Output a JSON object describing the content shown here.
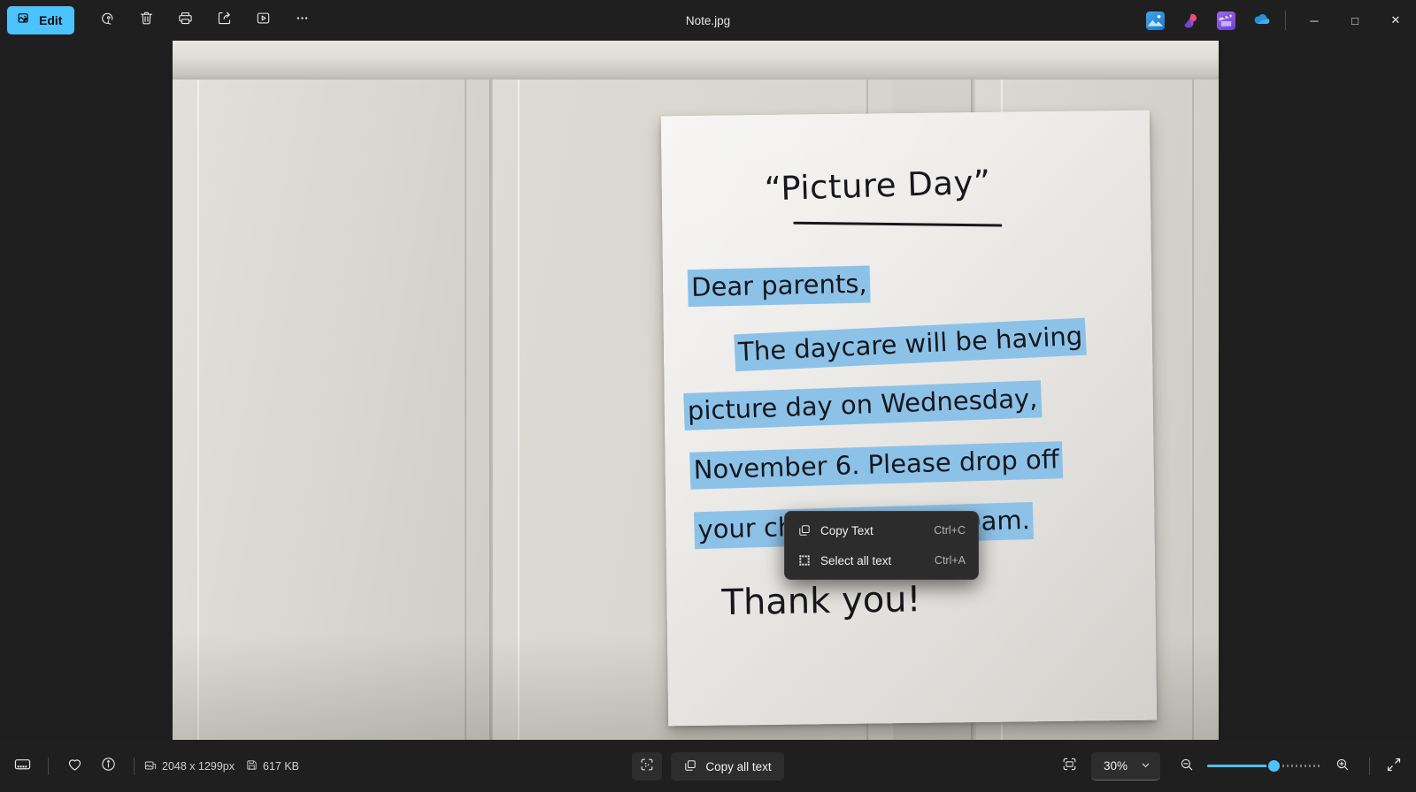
{
  "window": {
    "title": "Note.jpg",
    "accent_color": "#4cc2ff",
    "highlight_color": "#8dc2e8",
    "background_color": "#1f1f1f"
  },
  "toolbar": {
    "edit_label": "Edit",
    "buttons": [
      {
        "name": "edit-button",
        "label": "Edit",
        "icon": "edit-image-icon"
      },
      {
        "name": "rotate-button",
        "label": "Rotate",
        "icon": "rotate-icon"
      },
      {
        "name": "delete-button",
        "label": "Delete",
        "icon": "trash-icon"
      },
      {
        "name": "print-button",
        "label": "Print",
        "icon": "printer-icon"
      },
      {
        "name": "share-button",
        "label": "Share",
        "icon": "share-icon"
      },
      {
        "name": "slideshow-button",
        "label": "Slideshow",
        "icon": "play-box-icon"
      },
      {
        "name": "more-button",
        "label": "See more",
        "icon": "ellipsis-icon"
      }
    ],
    "app_icons": [
      {
        "name": "photos-app-icon",
        "label": "Photos"
      },
      {
        "name": "designer-app-icon",
        "label": "Designer"
      },
      {
        "name": "clipchamp-app-icon",
        "label": "Clipchamp"
      },
      {
        "name": "onedrive-app-icon",
        "label": "OneDrive"
      }
    ],
    "window_controls": {
      "minimize": "─",
      "maximize": "□",
      "close": "✕"
    }
  },
  "photo": {
    "alt": "Handwritten note taped to a white cabinet door",
    "note": {
      "title": "“Picture Day”",
      "lines": [
        "Dear parents,",
        "The daycare will be having",
        "picture day on Wednesday,",
        "November 6. Please drop off",
        "your child before 9:00am.",
        "Thank you!"
      ],
      "highlighted_lines": [
        0,
        1,
        2,
        3,
        4
      ]
    }
  },
  "context_menu": {
    "items": [
      {
        "name": "copy-text",
        "label": "Copy Text",
        "accel": "Ctrl+C",
        "icon": "copy-icon"
      },
      {
        "name": "select-all-text",
        "label": "Select all text",
        "accel": "Ctrl+A",
        "icon": "select-all-icon"
      }
    ]
  },
  "statusbar": {
    "left_icons": [
      {
        "name": "filmstrip-toggle-button",
        "label": "Filmstrip"
      },
      {
        "name": "favorite-button",
        "label": "Add to favorites"
      },
      {
        "name": "info-button",
        "label": "File info"
      }
    ],
    "dimensions": "2048 x 1299px",
    "filesize": "617 KB",
    "scan_text_label": "Scan text",
    "copy_all_text_label": "Copy all text",
    "fit_label": "Fit to window",
    "zoom_level": "30%",
    "zoom_out_label": "Zoom out",
    "zoom_in_label": "Zoom in",
    "fullscreen_label": "Full screen",
    "slider_percent": 58
  }
}
